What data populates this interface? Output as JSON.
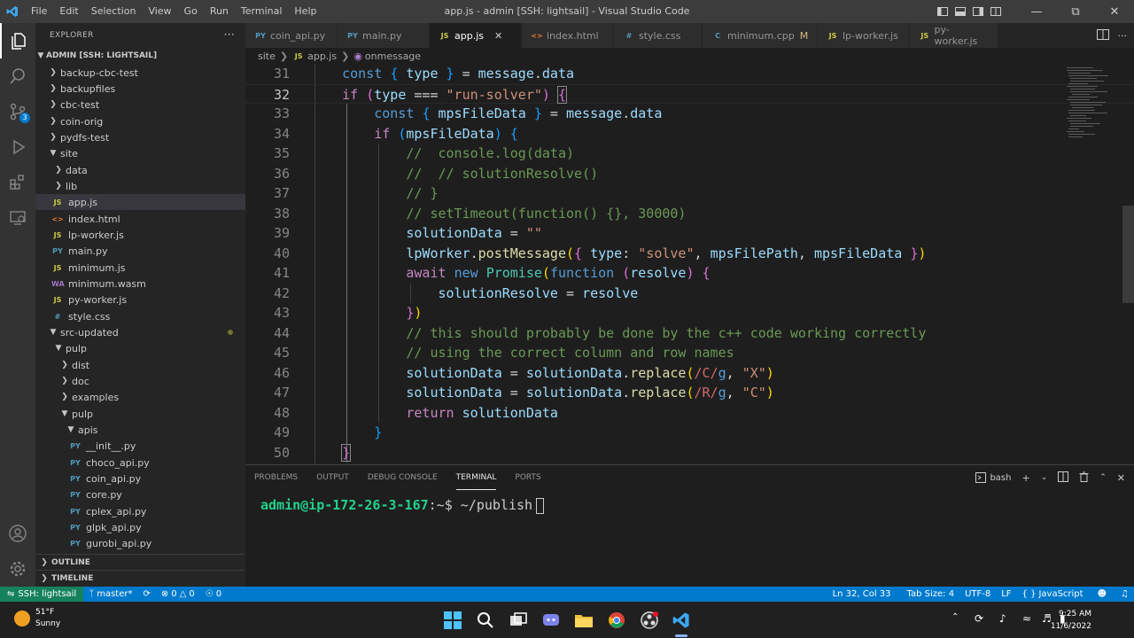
{
  "titlebar": {
    "menu": [
      "File",
      "Edit",
      "Selection",
      "View",
      "Go",
      "Run",
      "Terminal",
      "Help"
    ],
    "title": "app.js - admin [SSH: lightsail] - Visual Studio Code"
  },
  "sidebar": {
    "title": "EXPLORER",
    "root": "ADMIN [SSH: LIGHTSAIL]",
    "items": [
      {
        "label": "backup-cbc-test"
      },
      {
        "label": "backupfiles"
      },
      {
        "label": "cbc-test"
      },
      {
        "label": "coin-orig"
      },
      {
        "label": "pydfs-test"
      },
      {
        "label": "site"
      },
      {
        "label": "data"
      },
      {
        "label": "lib"
      },
      {
        "label": "app.js",
        "icon": "JS"
      },
      {
        "label": "index.html",
        "icon": "<>"
      },
      {
        "label": "lp-worker.js",
        "icon": "JS"
      },
      {
        "label": "main.py",
        "icon": "PY"
      },
      {
        "label": "minimum.js",
        "icon": "JS"
      },
      {
        "label": "minimum.wasm",
        "icon": "WA"
      },
      {
        "label": "py-worker.js",
        "icon": "JS"
      },
      {
        "label": "style.css",
        "icon": "#"
      },
      {
        "label": "src-updated"
      },
      {
        "label": "pulp"
      },
      {
        "label": "dist"
      },
      {
        "label": "doc"
      },
      {
        "label": "examples"
      },
      {
        "label": "pulp"
      },
      {
        "label": "apis"
      },
      {
        "label": "__init__.py",
        "icon": "PY"
      },
      {
        "label": "choco_api.py",
        "icon": "PY"
      },
      {
        "label": "coin_api.py",
        "icon": "PY"
      },
      {
        "label": "core.py",
        "icon": "PY"
      },
      {
        "label": "cplex_api.py",
        "icon": "PY"
      },
      {
        "label": "glpk_api.py",
        "icon": "PY"
      },
      {
        "label": "gurobi_api.py",
        "icon": "PY"
      }
    ],
    "outline": "OUTLINE",
    "timeline": "TIMELINE"
  },
  "tabs": [
    {
      "label": "coin_api.py",
      "icon": "PY"
    },
    {
      "label": "main.py",
      "icon": "PY"
    },
    {
      "label": "app.js",
      "icon": "JS"
    },
    {
      "label": "index.html",
      "icon": "<>"
    },
    {
      "label": "style.css",
      "icon": "#"
    },
    {
      "label": "minimum.cpp",
      "icon": "C",
      "flag": "M"
    },
    {
      "label": "lp-worker.js",
      "icon": "JS"
    },
    {
      "label": "py-worker.js",
      "icon": "JS"
    }
  ],
  "breadcrumb": [
    "site",
    "app.js",
    "onmessage"
  ],
  "editor": {
    "line_numbers": [
      "31",
      "32",
      "33",
      "34",
      "35",
      "36",
      "37",
      "38",
      "39",
      "40",
      "41",
      "42",
      "43",
      "44",
      "45",
      "46",
      "47",
      "48",
      "49",
      "50"
    ],
    "current_line": "32"
  },
  "panel": {
    "tabs": [
      "PROBLEMS",
      "OUTPUT",
      "DEBUG CONSOLE",
      "TERMINAL",
      "PORTS"
    ],
    "shell": "bash",
    "prompt": "admin@ip-172-26-3-167",
    "prompt_suffix": ":~$",
    "command": " ~/publish"
  },
  "statusbar": {
    "remote": "SSH: lightsail",
    "branch": "master*",
    "errors": "0",
    "warnings": "0",
    "ports": "0",
    "position": "Ln 32, Col 33",
    "tabsize": "Tab Size: 4",
    "encoding": "UTF-8",
    "eol": "LF",
    "language": "JavaScript"
  },
  "taskbar": {
    "temperature": "51°F",
    "condition": "Sunny",
    "time": "9:25 AM",
    "date": "11/6/2022"
  },
  "colors": {
    "statusbar": "#007acc",
    "remote": "#16825d",
    "editor_bg": "#1e1e1e"
  }
}
